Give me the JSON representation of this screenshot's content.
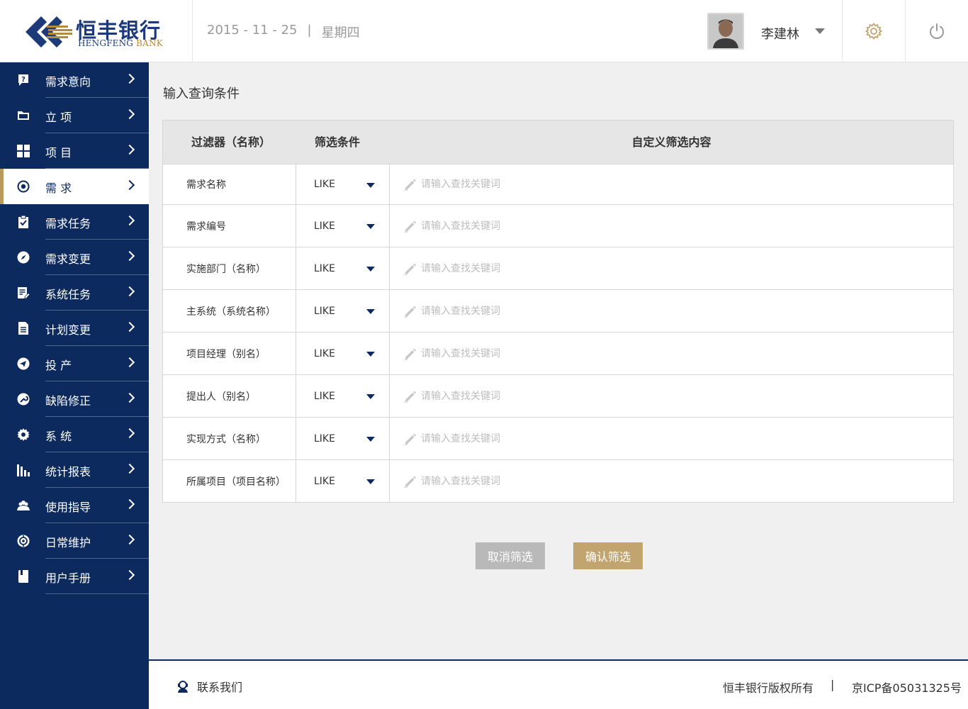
{
  "brand": {
    "name_cn": "恒丰银行",
    "name_en_1": "HENGFENG",
    "name_en_2": "BANK"
  },
  "header": {
    "date": "2015 - 11 - 25",
    "date_sep": "|",
    "weekday": "星期四",
    "user_name": "李建林",
    "icons": {
      "settings": "gear-icon",
      "power": "power-icon",
      "dropdown": "caret-down-icon"
    }
  },
  "sidebar": {
    "items": [
      {
        "label": "需求意向",
        "icon": "question-icon"
      },
      {
        "label": "立 项",
        "icon": "folder-icon"
      },
      {
        "label": "项 目",
        "icon": "grid-icon"
      },
      {
        "label": "需 求",
        "icon": "target-icon",
        "active": true
      },
      {
        "label": "需求任务",
        "icon": "clipboard-check-icon"
      },
      {
        "label": "需求变更",
        "icon": "compass-icon"
      },
      {
        "label": "系统任务",
        "icon": "document-edit-icon"
      },
      {
        "label": "计划变更",
        "icon": "document-icon"
      },
      {
        "label": "投 产",
        "icon": "send-icon"
      },
      {
        "label": "缺陷修正",
        "icon": "wrench-icon"
      },
      {
        "label": "系 统",
        "icon": "gear-icon"
      },
      {
        "label": "统计报表",
        "icon": "bar-chart-icon"
      },
      {
        "label": "使用指导",
        "icon": "people-icon"
      },
      {
        "label": "日常维护",
        "icon": "maintenance-icon"
      },
      {
        "label": "用户手册",
        "icon": "book-icon"
      }
    ],
    "colors": {
      "background": "#0c2a5e",
      "active_accent": "#b89a5e"
    }
  },
  "main": {
    "title": "输入查询条件",
    "table": {
      "headers": [
        "过滤器（名称）",
        "筛选条件",
        "自定义筛选内容"
      ],
      "placeholder": "请输入查找关键词",
      "rows": [
        {
          "filter": "需求名称",
          "condition": "LIKE",
          "value": ""
        },
        {
          "filter": "需求编号",
          "condition": "LIKE",
          "value": ""
        },
        {
          "filter": "实施部门（名称）",
          "condition": "LIKE",
          "value": ""
        },
        {
          "filter": "主系统（系统名称）",
          "condition": "LIKE",
          "value": ""
        },
        {
          "filter": "项目经理（别名）",
          "condition": "LIKE",
          "value": ""
        },
        {
          "filter": "提出人（别名）",
          "condition": "LIKE",
          "value": ""
        },
        {
          "filter": "实现方式（名称）",
          "condition": "LIKE",
          "value": ""
        },
        {
          "filter": "所属项目（项目名称）",
          "condition": "LIKE",
          "value": ""
        }
      ]
    },
    "buttons": {
      "cancel": "取消筛选",
      "confirm": "确认筛选"
    },
    "colors": {
      "confirm": "#c2a46e",
      "cancel": "#b9b9b9"
    }
  },
  "footer": {
    "contact": "联系我们",
    "copyright": "恒丰银行版权所有",
    "sep": "|",
    "icp": "京ICP备05031325号"
  }
}
